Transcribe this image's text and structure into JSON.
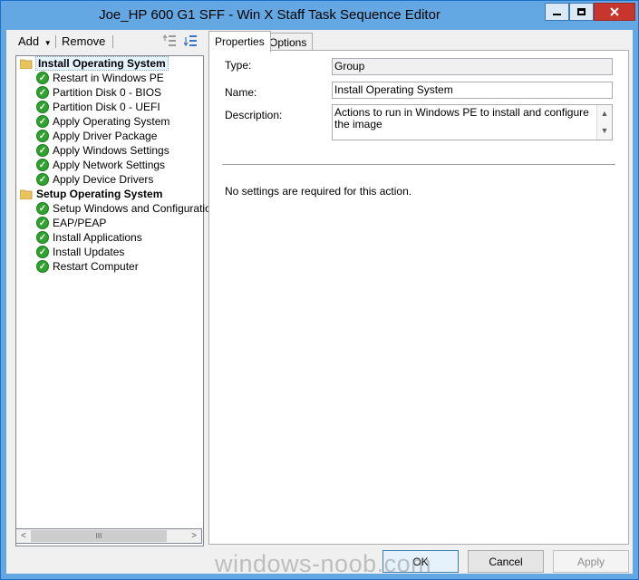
{
  "window": {
    "title": "Joe_HP 600 G1 SFF - Win X Staff Task Sequence Editor",
    "controls": {
      "minimize": "minimize",
      "maximize": "maximize",
      "close": "close"
    }
  },
  "toolbar": {
    "add_label": "Add",
    "remove_label": "Remove",
    "move_up_icon": "move-up-icon",
    "move_down_icon": "move-down-icon"
  },
  "tree": {
    "groups": [
      {
        "label": "Install Operating System",
        "selected": true,
        "icon": "folder-icon",
        "items": [
          "Restart in Windows PE",
          "Partition Disk 0 - BIOS",
          "Partition Disk 0 - UEFI",
          "Apply Operating System",
          "Apply Driver Package",
          "Apply Windows Settings",
          "Apply Network Settings",
          "Apply Device Drivers"
        ]
      },
      {
        "label": "Setup Operating System",
        "selected": false,
        "icon": "folder-icon",
        "items": [
          "Setup Windows and Configuration",
          "EAP/PEAP",
          "Install Applications",
          "Install Updates",
          "Restart Computer"
        ]
      }
    ],
    "scroll_left_glyph": "<",
    "scroll_right_glyph": ">",
    "scroll_thumb_glyph": "III"
  },
  "tabs": [
    {
      "label": "Properties",
      "active": true
    },
    {
      "label": "Options",
      "active": false
    }
  ],
  "properties": {
    "type_label": "Type:",
    "type_value": "Group",
    "name_label": "Name:",
    "name_value": "Install Operating System",
    "description_label": "Description:",
    "description_value": "Actions to run in Windows PE to install and configure the image",
    "no_settings_text": "No settings are required  for this action."
  },
  "buttons": {
    "ok": "OK",
    "cancel": "Cancel",
    "apply": "Apply"
  },
  "watermark": "windows-noob.com",
  "colors": {
    "title_bar": "#63a8e3",
    "close_button": "#c7352c",
    "check_green": "#2ea32e",
    "folder_yellow": "#e8c35a"
  }
}
